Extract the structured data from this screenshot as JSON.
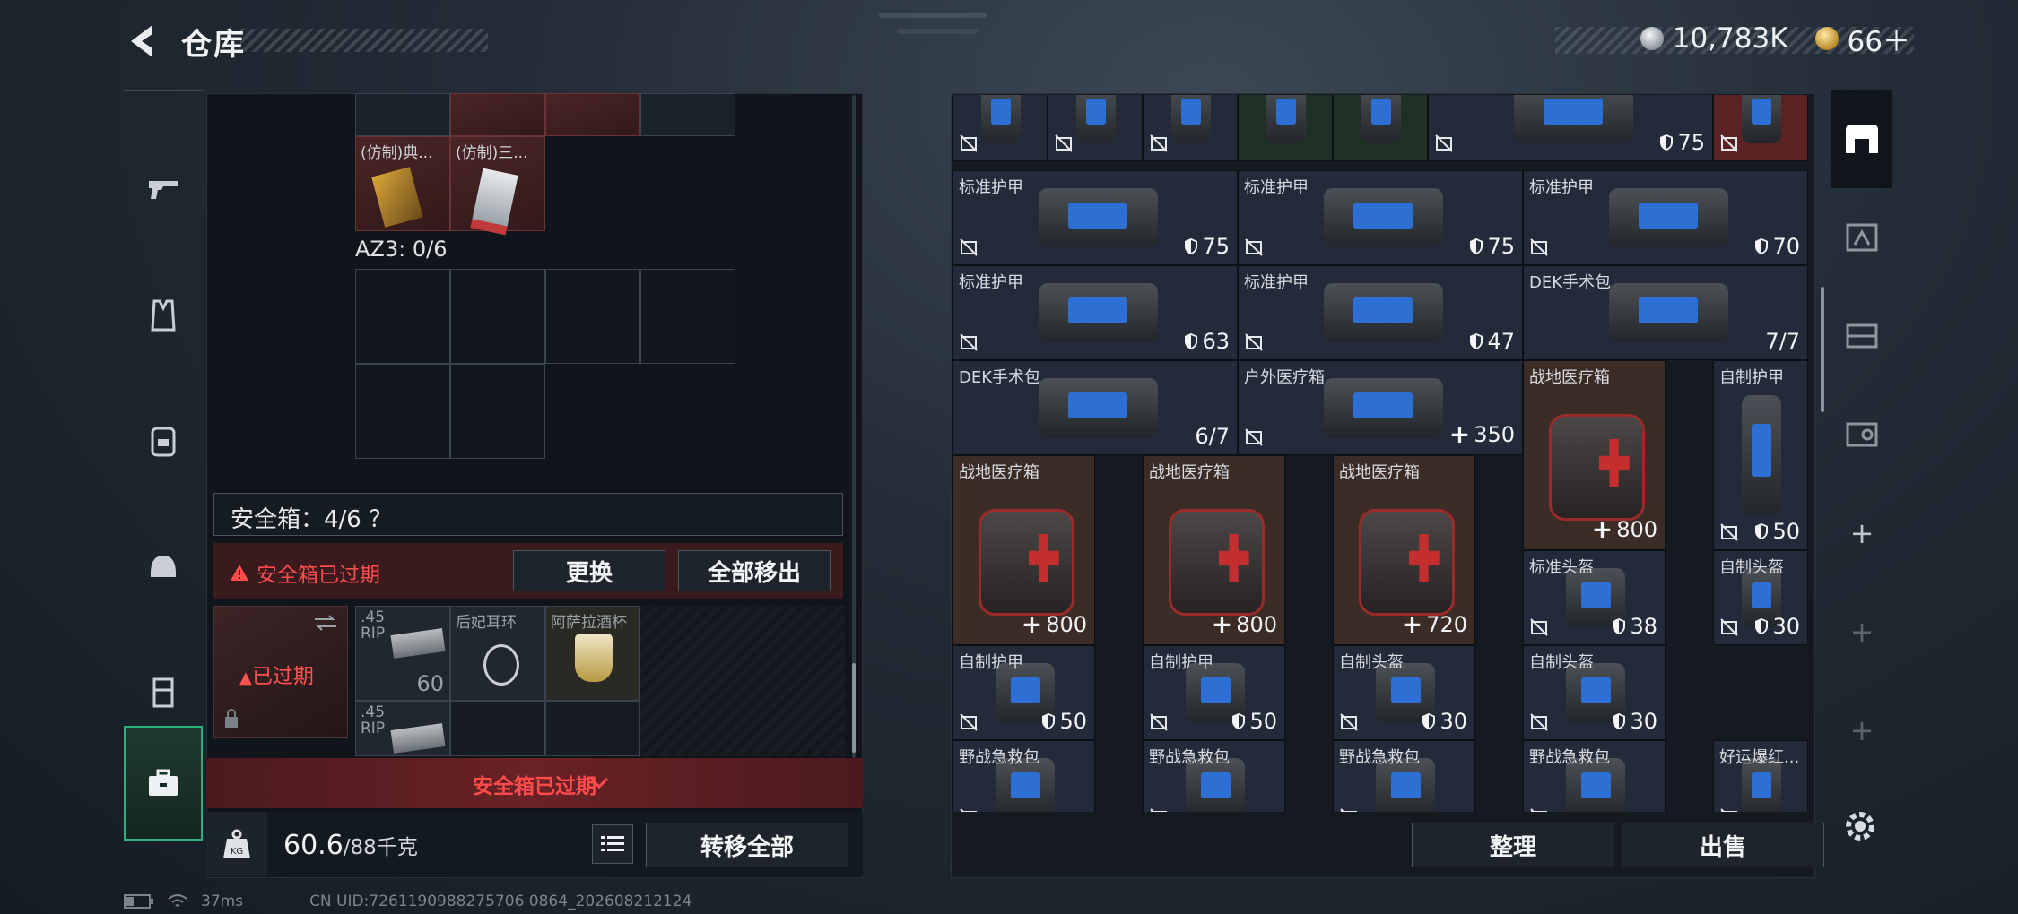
{
  "header": {
    "title": "仓库",
    "silver": "10,783K",
    "gold": "66＋"
  },
  "sidebar": {
    "items": [
      "pistol-icon",
      "vest-icon",
      "backpack-icon",
      "helmet-icon",
      "case-icon",
      "toolbox-icon"
    ]
  },
  "left": {
    "top_items": [
      "(仿制)典...",
      "(仿制)三..."
    ],
    "az3_label": "AZ3: 0/6",
    "safe_label": "安全箱：4/6 ？",
    "alert": "安全箱已过期",
    "btn_replace": "更换",
    "btn_remove_all": "全部移出",
    "expired_badge": "已过期",
    "safe_items": [
      {
        "name": ".45 RIP",
        "count": "60"
      },
      {
        "name": "后妃耳环",
        "count": ""
      },
      {
        "name": "阿萨拉酒杯",
        "count": ""
      },
      {
        "name": ".45 RIP",
        "count": ""
      }
    ],
    "expired_footer": "安全箱已过期",
    "weight_main": "60.6",
    "weight_sub": "/88千克",
    "btn_transfer": "转移全部"
  },
  "grid": {
    "items": [
      {
        "name": "",
        "value": ""
      },
      {
        "name": "",
        "value": ""
      },
      {
        "name": "",
        "value": ""
      },
      {
        "name": "",
        "value": ""
      },
      {
        "name": "",
        "value": ""
      },
      {
        "name": "",
        "value": "75"
      },
      {
        "name": "",
        "value": ""
      },
      {
        "name": "标准护甲",
        "value": "75"
      },
      {
        "name": "标准护甲",
        "value": "75"
      },
      {
        "name": "标准护甲",
        "value": "70"
      },
      {
        "name": "标准护甲",
        "value": "63"
      },
      {
        "name": "标准护甲",
        "value": "47"
      },
      {
        "name": "DEK手术包",
        "value": "7/7"
      },
      {
        "name": "DEK手术包",
        "value": "6/7"
      },
      {
        "name": "户外医疗箱",
        "value": "350"
      },
      {
        "name": "战地医疗箱",
        "value": "800"
      },
      {
        "name": "自制护甲",
        "value": "50"
      },
      {
        "name": "战地医疗箱",
        "value": "800"
      },
      {
        "name": "战地医疗箱",
        "value": "800"
      },
      {
        "name": "战地医疗箱",
        "value": "720"
      },
      {
        "name": "标准头盔",
        "value": "38"
      },
      {
        "name": "自制头盔",
        "value": "30"
      },
      {
        "name": "自制护甲",
        "value": "50"
      },
      {
        "name": "自制护甲",
        "value": "50"
      },
      {
        "name": "自制头盔",
        "value": "30"
      },
      {
        "name": "自制头盔",
        "value": "30"
      },
      {
        "name": "野战急救包",
        "value": ""
      },
      {
        "name": "野战急救包",
        "value": ""
      },
      {
        "name": "野战急救包",
        "value": ""
      },
      {
        "name": "野战急救包",
        "value": ""
      },
      {
        "name": "好运爆红...",
        "value": ""
      }
    ],
    "btn_sort": "整理",
    "btn_sell": "出售"
  },
  "status": {
    "ping": "37ms",
    "uid": "CN UID:7261190988275706 0864_202608212124"
  },
  "colors": {
    "accent_green": "#2db07a",
    "alert_red": "#ff4b4b",
    "medical_bg": "#3b2c26",
    "armor_bg": "#232b3a"
  }
}
